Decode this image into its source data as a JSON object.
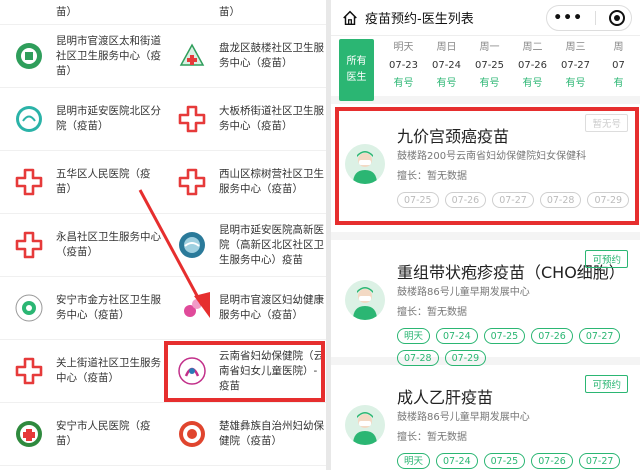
{
  "left_list": {
    "hospitals": [
      {
        "name": "苗）"
      },
      {
        "name": "苗）"
      },
      {
        "name": "昆明市官渡区太和街道社区卫生服务中心（疫苗）"
      },
      {
        "name": "盘龙区鼓楼社区卫生服务中心（疫苗）"
      },
      {
        "name": "昆明市延安医院北区分院（疫苗）"
      },
      {
        "name": "大板桥街道社区卫生服务中心（疫苗）"
      },
      {
        "name": "五华区人民医院（疫苗）"
      },
      {
        "name": "西山区棕树营社区卫生服务中心（疫苗）"
      },
      {
        "name": "永昌社区卫生服务中心（疫苗）"
      },
      {
        "name": "昆明市延安医院高新医院（高新区北区社区卫生服务中心）疫苗"
      },
      {
        "name": "安宁市金方社区卫生服务中心（疫苗）"
      },
      {
        "name": "昆明市官渡区妇幼健康服务中心（疫苗）"
      },
      {
        "name": "关上街道社区卫生服务中心（疫苗）"
      },
      {
        "name": "云南省妇幼保健院（云南省妇女儿童医院）-疫苗"
      },
      {
        "name": "安宁市人民医院（疫苗）"
      },
      {
        "name": "楚雄彝族自治州妇幼保健院（疫苗）"
      }
    ]
  },
  "right_panel": {
    "title": "疫苗预约-医生列表",
    "capsule_menu": "•••",
    "all_doctors": [
      "所有",
      "医生"
    ],
    "dates": [
      {
        "weekday": "明天",
        "date": "07-23",
        "status": "有号"
      },
      {
        "weekday": "周日",
        "date": "07-24",
        "status": "有号"
      },
      {
        "weekday": "周一",
        "date": "07-25",
        "status": "有号"
      },
      {
        "weekday": "周二",
        "date": "07-26",
        "status": "有号"
      },
      {
        "weekday": "周三",
        "date": "07-27",
        "status": "有号"
      },
      {
        "weekday": "周",
        "date": "07",
        "status": "有"
      }
    ],
    "vaccines": [
      {
        "name": "九价宫颈癌疫苗",
        "location": "鼓楼路200号云南省妇幼保健院妇女保健科",
        "skill": "擅长：暂无数据",
        "badge": "暂无号",
        "badge_available": false,
        "chips": [
          {
            "label": "07-25",
            "on": false
          },
          {
            "label": "07-26",
            "on": false
          },
          {
            "label": "07-27",
            "on": false
          },
          {
            "label": "07-28",
            "on": false
          },
          {
            "label": "07-29",
            "on": false
          }
        ]
      },
      {
        "name": "重组带状疱疹疫苗（CHO细胞）",
        "location": "鼓楼路86号儿童早期发展中心",
        "skill": "擅长：暂无数据",
        "badge": "可预约",
        "badge_available": true,
        "chips": [
          {
            "label": "明天",
            "on": true
          },
          {
            "label": "07-24",
            "on": true
          },
          {
            "label": "07-25",
            "on": true
          },
          {
            "label": "07-26",
            "on": true
          },
          {
            "label": "07-27",
            "on": true
          },
          {
            "label": "07-28",
            "on": true
          },
          {
            "label": "07-29",
            "on": true
          }
        ]
      },
      {
        "name": "成人乙肝疫苗",
        "location": "鼓楼路86号儿童早期发展中心",
        "skill": "擅长：暂无数据",
        "badge": "可预约",
        "badge_available": true,
        "chips": [
          {
            "label": "明天",
            "on": true
          },
          {
            "label": "07-24",
            "on": true
          },
          {
            "label": "07-25",
            "on": true
          },
          {
            "label": "07-26",
            "on": true
          },
          {
            "label": "07-27",
            "on": true
          }
        ]
      }
    ]
  },
  "colors": {
    "accent_green": "#2bb673",
    "highlight_red": "#e62e2e"
  }
}
